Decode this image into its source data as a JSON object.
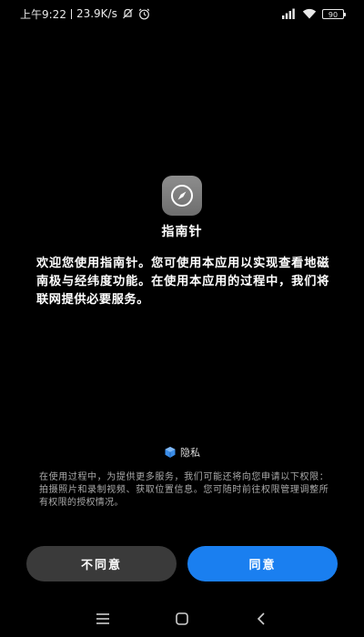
{
  "status_bar": {
    "time": "上午9:22",
    "net_speed": "23.9K/s",
    "battery": "90"
  },
  "app": {
    "name": "指南针",
    "welcome_text": "欢迎您使用指南针。您可使用本应用以实现查看地磁南极与经纬度功能。在使用本应用的过程中，我们将联网提供必要服务。"
  },
  "privacy": {
    "title": "隐私",
    "description": "在使用过程中，为提供更多服务，我们可能还将向您申请以下权限：拍摄照片和录制视频、获取位置信息。您可随时前往权限管理调整所有权限的授权情况。"
  },
  "buttons": {
    "disagree": "不同意",
    "agree": "同意"
  },
  "colors": {
    "accent": "#1a7ff0",
    "secondary_button": "#3a3a3a",
    "background": "#000000"
  },
  "icons": {
    "app": "compass-icon",
    "privacy": "privacy-shield-icon"
  }
}
